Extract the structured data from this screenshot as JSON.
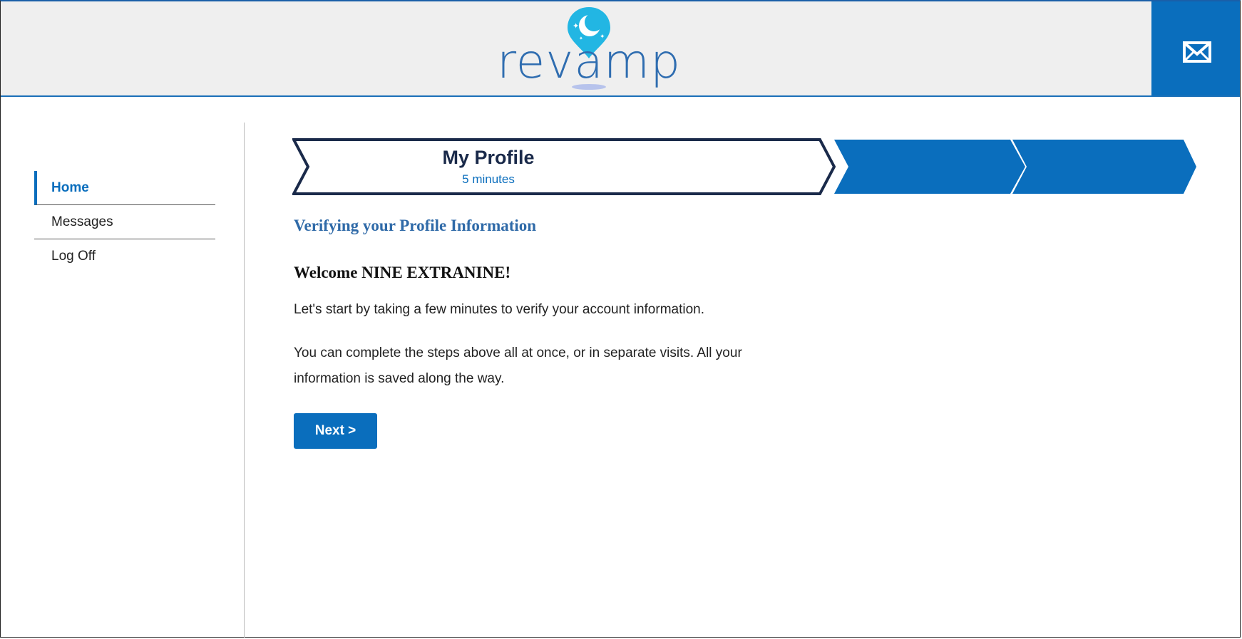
{
  "header": {
    "logo_text": "revamp",
    "mail_icon": "envelope-icon"
  },
  "sidebar": {
    "items": [
      {
        "label": "Home",
        "active": true
      },
      {
        "label": "Messages",
        "active": false
      },
      {
        "label": "Log Off",
        "active": false
      }
    ]
  },
  "progress": {
    "current_step": {
      "title": "My Profile",
      "duration": "5 minutes"
    },
    "total_steps": 3
  },
  "main": {
    "section_title": "Verifying your Profile Information",
    "welcome": "Welcome NINE EXTRANINE!",
    "intro": "Let's start by taking a few minutes to verify your account information.",
    "note": "You can complete the steps above all at once, or in separate visits. All your information is saved along the way.",
    "next_label": "Next >"
  },
  "colors": {
    "accent": "#0a6ebd",
    "header_bg": "#efefef",
    "step_outline": "#1a2a4a",
    "heading_blue": "#2f6aa8"
  }
}
